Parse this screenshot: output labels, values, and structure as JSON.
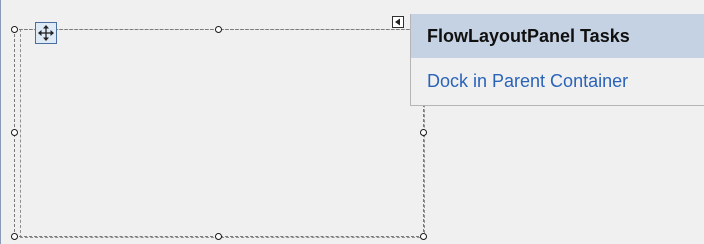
{
  "designer": {
    "control_type": "FlowLayoutPanel",
    "selection_handles": [
      "top-left",
      "top-center",
      "top-right",
      "middle-left",
      "middle-right",
      "bottom-left",
      "bottom-center",
      "bottom-right"
    ],
    "move_glyph_icon": "move-arrows-icon",
    "smart_tag_icon": "triangle-left-icon"
  },
  "tasks_panel": {
    "title": "FlowLayoutPanel Tasks",
    "items": [
      {
        "label": "Dock in Parent Container"
      }
    ]
  },
  "colors": {
    "header_background": "#c5d2e3",
    "link": "#2a63b8",
    "surface": "#f0f0f0"
  }
}
